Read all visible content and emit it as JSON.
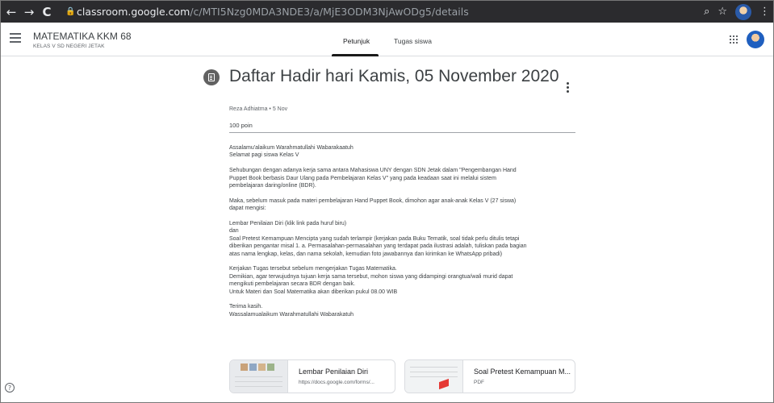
{
  "browser": {
    "back_icon": "←",
    "forward_icon": "→",
    "reload_icon": "C",
    "url_host": "classroom.google.com",
    "url_path": "/c/MTI5Nzg0MDA3NDE3/a/MjE3ODM3NjAwODg5/details",
    "zoom_icon": "⌕",
    "star_icon": "☆",
    "menu_icon": "⋮"
  },
  "header": {
    "class_name": "MATEMATIKA KKM 68",
    "class_section": "KELAS V SD NEGERI JETAK",
    "tabs": [
      {
        "label": "Petunjuk",
        "active": true
      },
      {
        "label": "Tugas siswa",
        "active": false
      }
    ]
  },
  "assignment": {
    "title": "Daftar Hadir hari Kamis, 05 November 2020",
    "meta": "Reza Adhiatma • 5 Nov",
    "points": "100 poin",
    "paragraphs": [
      [
        "Assalamu'alaikum Warahmatullahi Wabarakaatuh",
        "Selamat pagi siswa Kelas V"
      ],
      [
        "Sehubungan dengan adanya kerja sama antara Mahasiswa UNY dengan SDN Jetak dalam \"Pengembangan Hand",
        "Puppet Book berbasis Daur Ulang pada Pembelajaran Kelas V\" yang pada keadaan saat ini melalui sistem",
        "pembelajaran daring/online (BDR)."
      ],
      [
        "Maka, sebelum masuk pada materi pembelajaran Hand Puppet Book, dimohon agar anak-anak Kelas V (27 siswa)",
        "dapat mengisi:"
      ],
      [
        "Lembar Penilaian Diri (klik link pada huruf biru)",
        "dan",
        "Soal Pretest Kemampuan Mencipta yang sudah terlampir (kerjakan pada Buku Tematik, soal tidak perlu ditulis tetapi",
        "diberikan pengantar misal 1. a. Permasalahan-permasalahan yang terdapat pada ilustrasi adalah, tuliskan pada bagian",
        "atas nama lengkap, kelas, dan nama sekolah, kemudian foto jawabannya dan kirimkan ke WhatsApp pribadi)"
      ],
      [
        "Kerjakan Tugas tersebut sebelum mengerjakan Tugas Matematika.",
        "Demikian, agar terwujudnya tujuan kerja sama tersebut, mohon siswa yang didampingi orangtua/wali murid dapat",
        "mengikuti pembelajaran secara BDR dengan baik.",
        "Untuk Materi dan Soal Matematika akan diberikan pukul 08.00 WIB"
      ],
      [
        "Terima kasih.",
        "Wassalamualaikum Warahmatullahi Wabarakatuh"
      ]
    ]
  },
  "attachments": [
    {
      "title": "Lembar Penilaian Diri",
      "subtitle": "https://docs.google.com/forms/..."
    },
    {
      "title": "Soal Pretest Kemampuan M...",
      "subtitle": "PDF"
    }
  ],
  "colors": {
    "chrome_bg": "#2b2b2e",
    "tab_underline": "#1a1a1a",
    "text": "#3c4043"
  }
}
